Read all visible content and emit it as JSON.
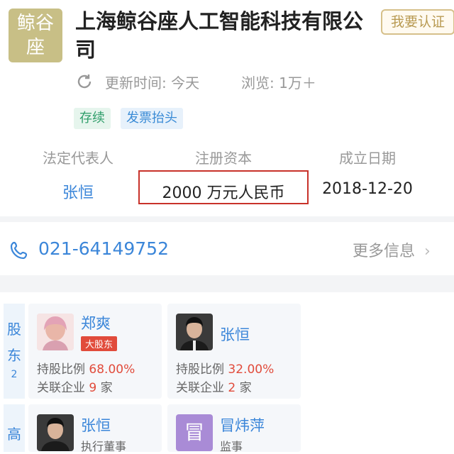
{
  "company": {
    "logo_text": "鲸谷座",
    "logo_line1": "鲸谷",
    "logo_line2": "座",
    "name": "上海鲸谷座人工智能科技有限公司",
    "claim_label": "我要认证",
    "update_text": "更新时间: 今天",
    "views_text": "浏览: 1万＋",
    "tags": [
      "存续",
      "发票抬头"
    ]
  },
  "info": {
    "legal_rep_label": "法定代表人",
    "legal_rep_value": "张恒",
    "capital_label": "注册资本",
    "capital_value": "2000 万元人民币",
    "founded_label": "成立日期",
    "founded_value": "2018-12-20"
  },
  "contact": {
    "phone": "021-64149752",
    "more_label": "更多信息"
  },
  "shareholders": {
    "section_char1": "股",
    "section_char2": "东",
    "count": "2",
    "items": [
      {
        "name": "郑爽",
        "badge": "大股东",
        "ratio_label": "持股比例",
        "ratio_value": "68.00%",
        "assoc_label": "关联企业",
        "assoc_count": "9",
        "assoc_unit": "家"
      },
      {
        "name": "张恒",
        "badge": "",
        "ratio_label": "持股比例",
        "ratio_value": "32.00%",
        "assoc_label": "关联企业",
        "assoc_count": "2",
        "assoc_unit": "家"
      }
    ]
  },
  "executives": {
    "section_char1": "高",
    "items": [
      {
        "name": "张恒",
        "role": "执行董事"
      },
      {
        "name": "冒炜萍",
        "role": "监事",
        "avatar_char": "冒"
      }
    ]
  },
  "colors": {
    "accent_blue": "#3b86d9",
    "highlight_red": "#c8322a",
    "logo_bg": "#c8bf86"
  }
}
